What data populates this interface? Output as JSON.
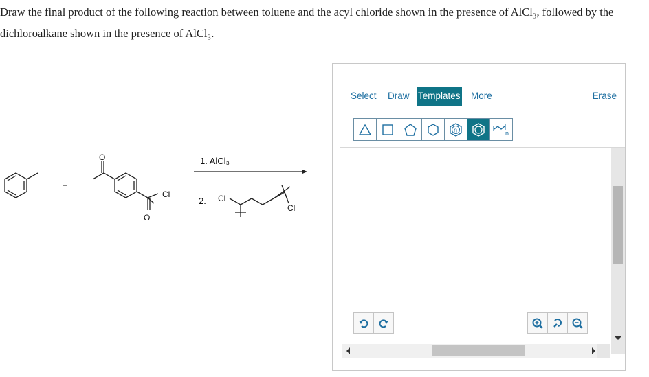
{
  "question": {
    "text": "Draw the final product of the following reaction between toluene and the acyl chloride shown in the presence of AlCl₃, followed by the dichloroalkane shown in the presence of AlCl₃."
  },
  "scheme": {
    "plus": "+",
    "step1": "1. AlCl₃",
    "step2": "2.",
    "cl": "Cl",
    "o": "O"
  },
  "editor": {
    "menu": {
      "select": "Select",
      "draw": "Draw",
      "templates": "Templates",
      "more": "More",
      "erase": "Erase"
    },
    "templates": [
      {
        "name": "cyclopropane",
        "selected": false
      },
      {
        "name": "cyclobutane",
        "selected": false
      },
      {
        "name": "cyclopentane",
        "selected": false
      },
      {
        "name": "cyclohexane",
        "selected": false
      },
      {
        "name": "chain-n",
        "selected": false
      },
      {
        "name": "benzene",
        "selected": true
      },
      {
        "name": "repeat-unit-n",
        "selected": false
      }
    ],
    "template_n_label": "n",
    "accent_color": "#0f7487",
    "link_color": "#1e6fa1"
  },
  "icons": {
    "undo": "undo-icon",
    "redo": "redo-icon",
    "zoom_in": "zoom-in-icon",
    "zoom_reset": "zoom-reset-icon",
    "zoom_out": "zoom-out-icon"
  }
}
